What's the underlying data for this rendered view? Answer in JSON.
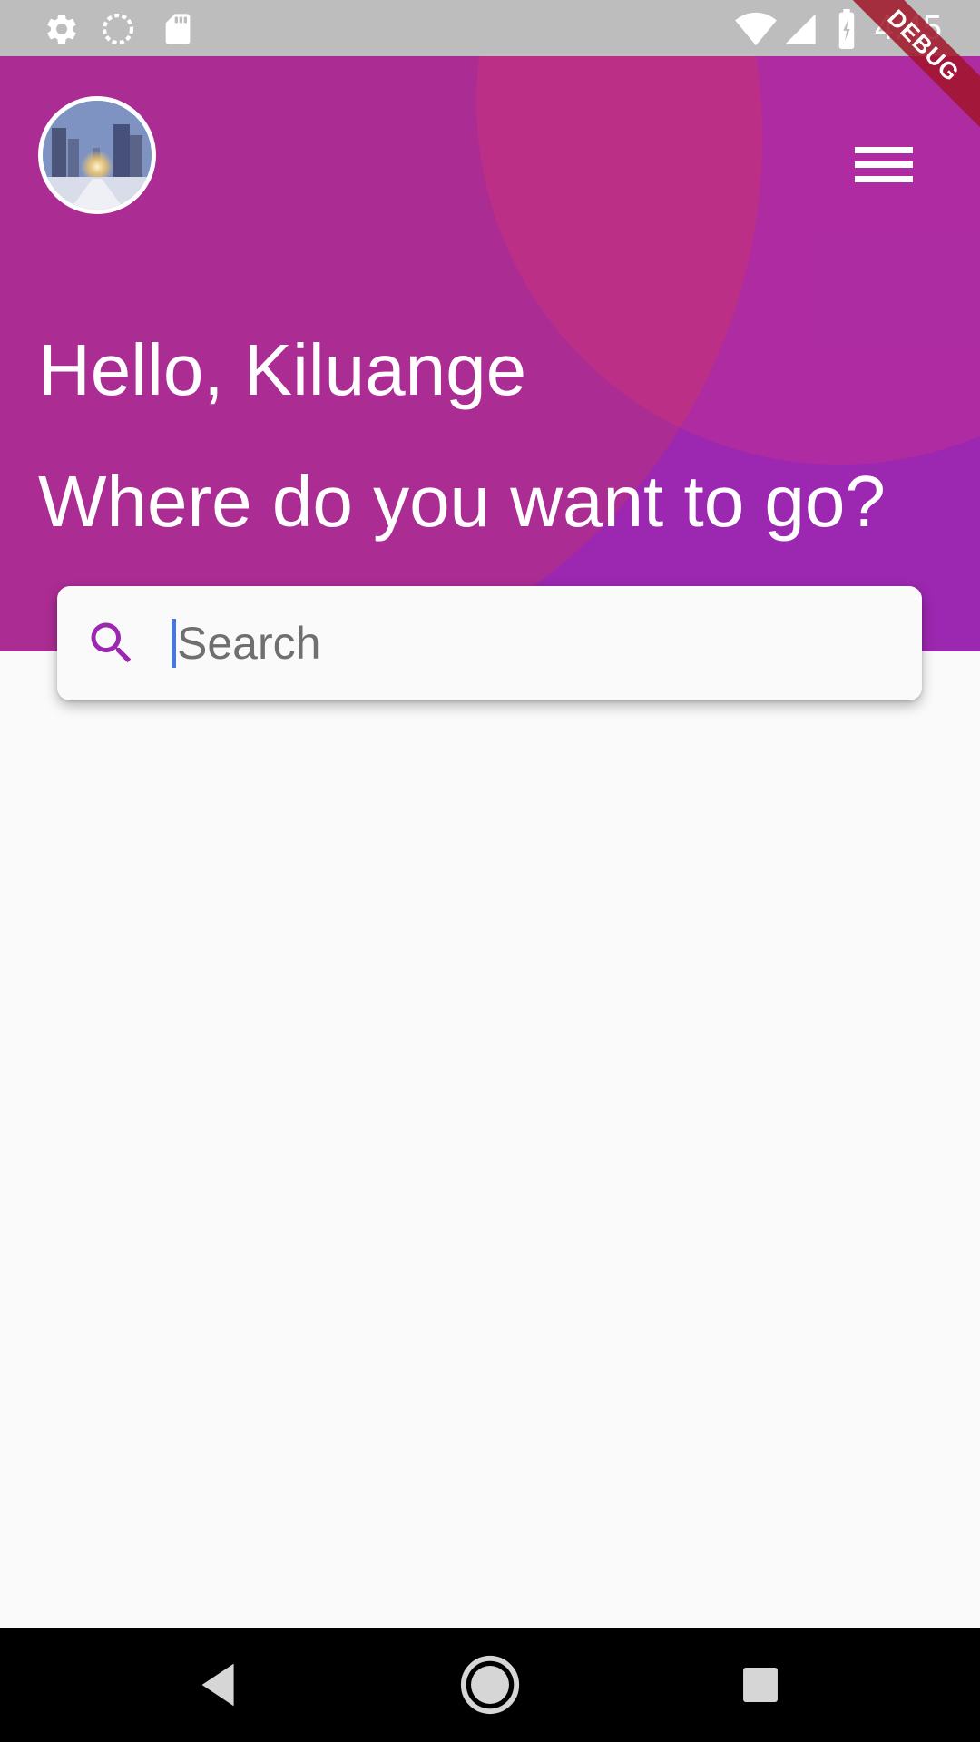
{
  "status_bar": {
    "time": "4:45",
    "icons": [
      "settings-icon",
      "sync-icon",
      "sd-card-icon",
      "wifi-icon",
      "cell-signal-icon",
      "battery-charging-icon"
    ]
  },
  "debug_banner": "DEBUG",
  "header": {
    "greeting": "Hello, Kiluange",
    "question": "Where do you want to go?",
    "menu_icon": "hamburger-menu-icon",
    "avatar_icon": "city-avatar-image"
  },
  "search": {
    "placeholder": "Search",
    "value": "",
    "icon": "search-icon"
  },
  "nav_bar": {
    "buttons": [
      "back-icon",
      "home-icon",
      "recents-icon"
    ]
  },
  "colors": {
    "primary": "#9c27b0",
    "header_circle": "#ab2c93",
    "accent_circle": "#bc2f86",
    "background": "#fafafa",
    "status_bar": "#bdbdbd",
    "caret": "#4a77d8"
  }
}
